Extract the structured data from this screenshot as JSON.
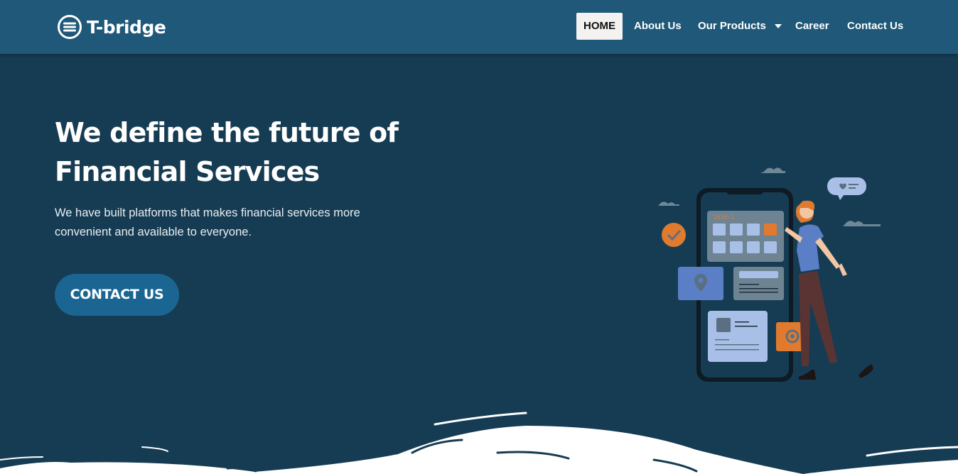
{
  "brand": {
    "name": "T-bridge",
    "logo_icon": "circle-equals-logo-icon"
  },
  "nav": {
    "items": [
      {
        "label": "HOME",
        "active": true
      },
      {
        "label": "About Us",
        "active": false
      },
      {
        "label": "Our Products",
        "active": false,
        "has_dropdown": true
      },
      {
        "label": "Career",
        "active": false
      },
      {
        "label": "Contact Us",
        "active": false
      }
    ]
  },
  "hero": {
    "title_line1": "We define the future of",
    "title_line2": "Financial Services",
    "subtitle_line1": "We have built platforms that makes financial services more",
    "subtitle_line2": "convenient and available to everyone.",
    "cta_label": "CONTACT US"
  },
  "illustration": {
    "phone_label": "2578-1"
  },
  "colors": {
    "header_bg": "#1f5878",
    "page_bg": "#163c53",
    "cta_bg": "#1b6593",
    "accent_orange": "#e07a2e",
    "accent_blue": "#5a7fc6"
  }
}
